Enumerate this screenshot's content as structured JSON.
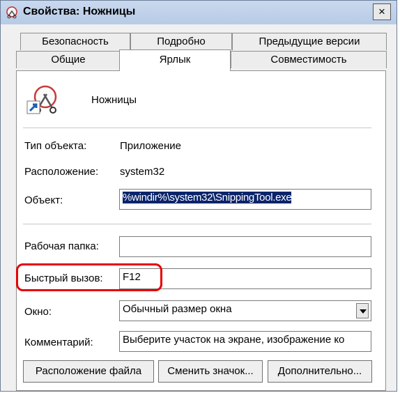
{
  "window": {
    "title": "Свойства: Ножницы",
    "close_label": "×"
  },
  "tabs": {
    "row_back": [
      "Безопасность",
      "Подробно",
      "Предыдущие версии"
    ],
    "row_front": [
      "Общие",
      "Ярлык",
      "Совместимость"
    ],
    "active": "Ярлык"
  },
  "shortcut": {
    "name": "Ножницы",
    "type_label": "Тип объекта:",
    "type_value": "Приложение",
    "location_label": "Расположение:",
    "location_value": "system32",
    "target_label": "Объект:",
    "target_value": "%windir%\\system32\\SnippingTool.exe",
    "start_in_label": "Рабочая папка:",
    "start_in_value": "",
    "hotkey_label": "Быстрый вызов:",
    "hotkey_value": "F12",
    "run_label": "Окно:",
    "run_value": "Обычный размер окна",
    "comment_label": "Комментарий:",
    "comment_value": "Выберите участок на экране, изображение ко"
  },
  "buttons": {
    "open_location": "Расположение файла",
    "change_icon": "Сменить значок...",
    "advanced": "Дополнительно..."
  },
  "colors": {
    "highlight": "#e60000",
    "selection": "#0a246a"
  }
}
